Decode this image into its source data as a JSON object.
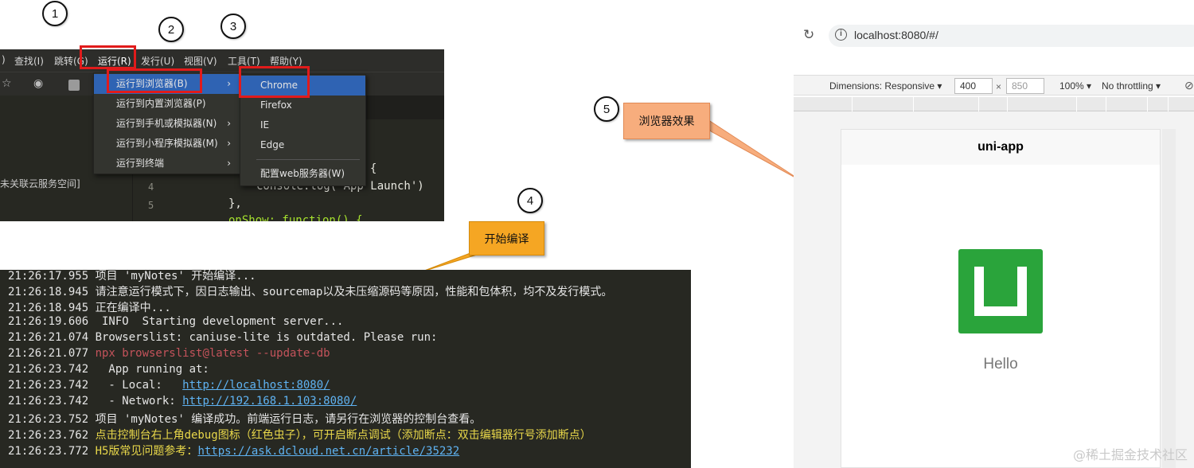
{
  "callouts": [
    "1",
    "2",
    "3",
    "4",
    "5"
  ],
  "ide": {
    "menubar": [
      ")",
      "查找(I)",
      "跳转(G)",
      "运行(R)",
      "发行(U)",
      "视图(V)",
      "工具(T)",
      "帮助(Y)"
    ],
    "sidebar_text": "未关联云服务空间]",
    "line_numbers": [
      "4",
      "5"
    ],
    "code_lines": [
      ") {",
      "console.log('App Launch')",
      "},",
      "onShow: function() {"
    ],
    "run_menu": [
      {
        "label": "运行到浏览器(B)",
        "arrow": "›"
      },
      {
        "label": "运行到内置浏览器(P)",
        "arrow": ""
      },
      {
        "label": "运行到手机或模拟器(N)",
        "arrow": "›"
      },
      {
        "label": "运行到小程序模拟器(M)",
        "arrow": "›"
      },
      {
        "label": "运行到终端",
        "arrow": "›"
      }
    ],
    "browser_menu": [
      "Chrome",
      "Firefox",
      "IE",
      "Edge",
      "配置web服务器(W)"
    ]
  },
  "notes": {
    "compile": "开始编译",
    "browser_effect": "浏览器效果"
  },
  "console": [
    {
      "text": "21:26:17.955 项目 'myNotes' 开始编译...",
      "style": "normal"
    },
    {
      "text": "21:26:18.945 请注意运行模式下，因日志输出、sourcemap以及未压缩源码等原因，性能和包体积，均不及发行模式。",
      "style": "normal"
    },
    {
      "text": "21:26:18.945 正在编译中...",
      "style": "normal"
    },
    {
      "text": "21:26:19.606  INFO  Starting development server...",
      "style": "normal"
    },
    {
      "text": "21:26:21.074 Browserslist: caniuse-lite is outdated. Please run:",
      "style": "normal"
    },
    {
      "text": "21:26:21.077 ",
      "extra": "npx browserslist@latest --update-db",
      "style": "red-tail"
    },
    {
      "text": "21:26:23.742   App running at:",
      "style": "normal"
    },
    {
      "text": "21:26:23.742   - Local:   ",
      "link": "http://localhost:8080/",
      "style": "link"
    },
    {
      "text": "21:26:23.742   - Network: ",
      "link": "http://192.168.1.103:8080/",
      "style": "link"
    },
    {
      "text": "21:26:23.752 项目 'myNotes' 编译成功。前端运行日志，请另行在浏览器的控制台查看。",
      "style": "normal"
    },
    {
      "text": "21:26:23.762 ",
      "extra": "点击控制台右上角debug图标（红色虫子），可开启断点调试（添加断点：双击编辑器行号添加断点）",
      "style": "yellow-tail"
    },
    {
      "text": "21:26:23.772 ",
      "extra": "H5版常见问题参考：",
      "link": "https://ask.dcloud.net.cn/article/35232",
      "style": "yellow-link"
    }
  ],
  "browser": {
    "url": "localhost:8080/#/",
    "dimensions_label": "Dimensions: Responsive ▾",
    "width": "400",
    "times": "×",
    "height": "850",
    "zoom": "100% ▾",
    "throttling": "No throttling ▾",
    "page_title": "uni-app",
    "hello_text": "Hello",
    "logo_color": "#2aa43b"
  },
  "watermark": "@稀土掘金技术社区"
}
